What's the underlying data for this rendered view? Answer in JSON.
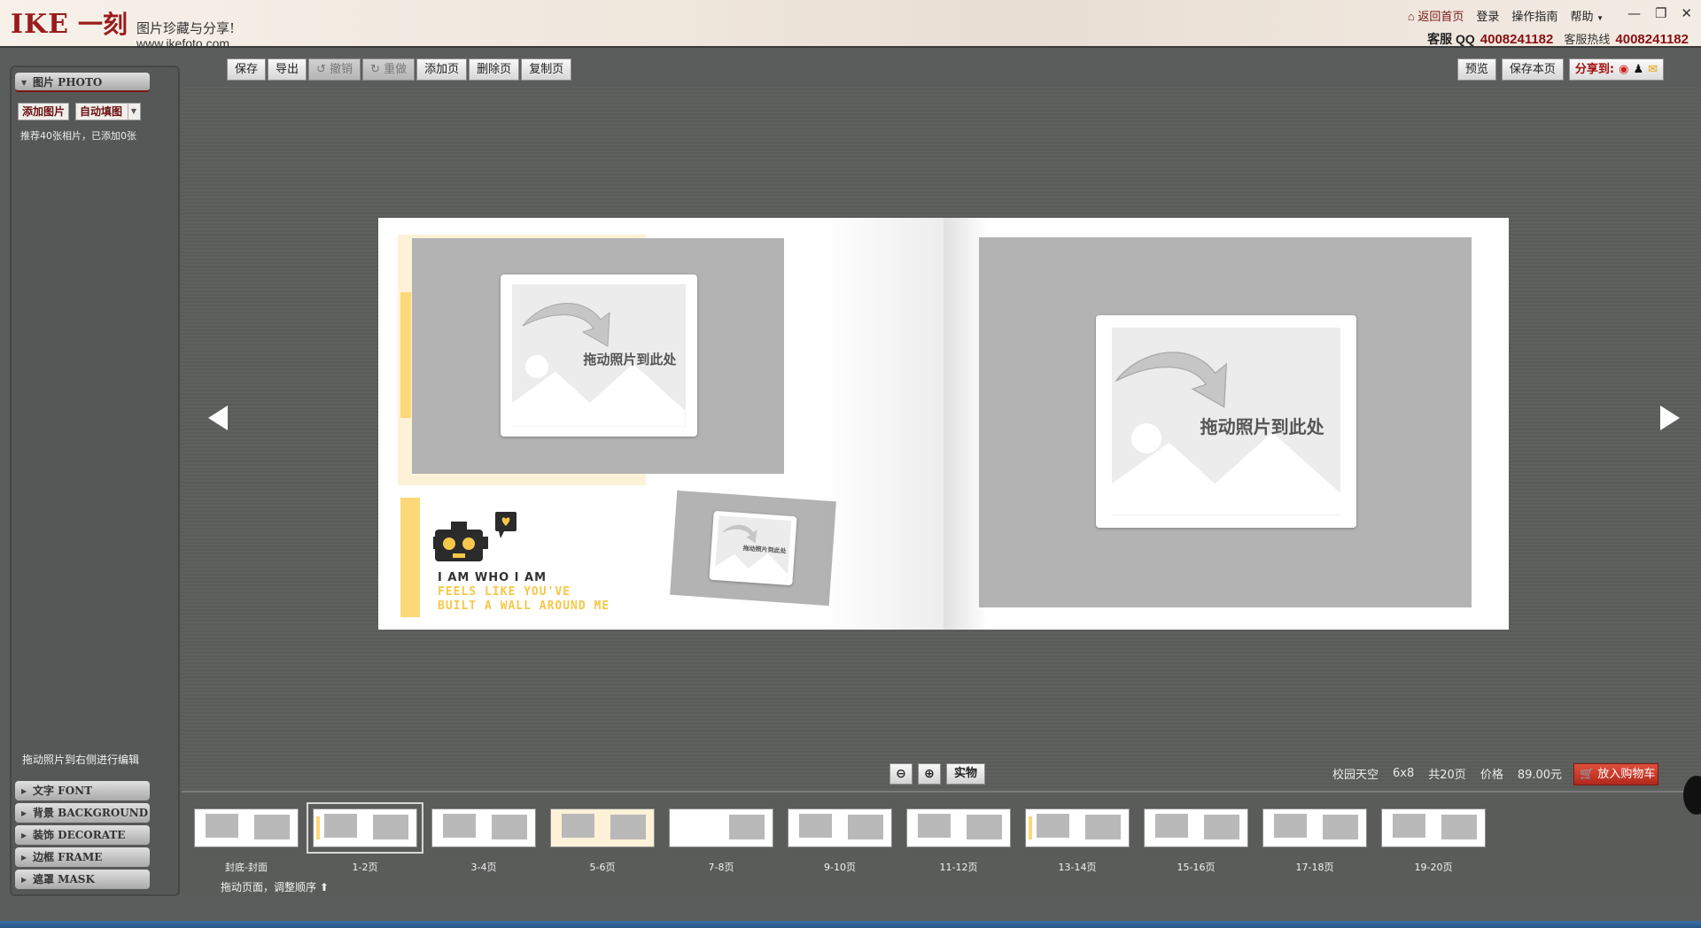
{
  "header": {
    "logo_ike": "IKE",
    "logo_yike": "一刻",
    "slogan": "图片珍藏与分享!",
    "url": "www.ikefoto.com",
    "nav": {
      "home": "返回首页",
      "login": "登录",
      "guide": "操作指南",
      "help": "帮助"
    },
    "window_controls": [
      "—",
      "❐",
      "✕"
    ],
    "contact": {
      "qq_label": "客服 QQ",
      "qq_number": "4008241182",
      "hotline_label": "客服热线",
      "hotline_number": "4008241182"
    }
  },
  "sidebar": {
    "photo_panel": "图片 PHOTO",
    "add_photo": "添加图片",
    "auto_fill": "自动填图",
    "hint": "推荐40张相片，已添加0张",
    "drag_hint": "拖动照片到右侧进行编辑",
    "panels": [
      {
        "label": "文字 FONT"
      },
      {
        "label": "背景 BACKGROUND"
      },
      {
        "label": "装饰 DECORATE"
      },
      {
        "label": "边框 FRAME"
      },
      {
        "label": "遮罩 MASK"
      }
    ]
  },
  "toolbar": {
    "save": "保存",
    "export": "导出",
    "undo": "撤销",
    "redo": "重做",
    "add_page": "添加页",
    "delete_page": "删除页",
    "copy_page": "复制页"
  },
  "right_toolbar": {
    "preview": "预览",
    "save_page": "保存本页",
    "share": "分享到:"
  },
  "spread": {
    "drop_text": "拖动照片到此处",
    "text_line1": "I AM WHO I AM",
    "text_line2": "FEELS LIKE YOU'VE",
    "text_line3": "BUILT A WALL AROUND ME"
  },
  "bottom": {
    "real_button": "实物",
    "template_name": "校园天空",
    "size": "6x8",
    "page_count": "共20页",
    "price_label": "价格",
    "price": "89.00元",
    "cart_button": "放入购物车",
    "drag_order": "拖动页面，调整顺序"
  },
  "thumbnails": [
    {
      "label": "封底-封面"
    },
    {
      "label": "1-2页"
    },
    {
      "label": "3-4页"
    },
    {
      "label": "5-6页"
    },
    {
      "label": "7-8页"
    },
    {
      "label": "9-10页"
    },
    {
      "label": "11-12页"
    },
    {
      "label": "13-14页"
    },
    {
      "label": "15-16页"
    },
    {
      "label": "17-18页"
    },
    {
      "label": "19-20页"
    }
  ],
  "colors": {
    "brand_red": "#9a1b1b",
    "accent_yellow": "#fcd878",
    "cart_red": "#c8382a"
  }
}
